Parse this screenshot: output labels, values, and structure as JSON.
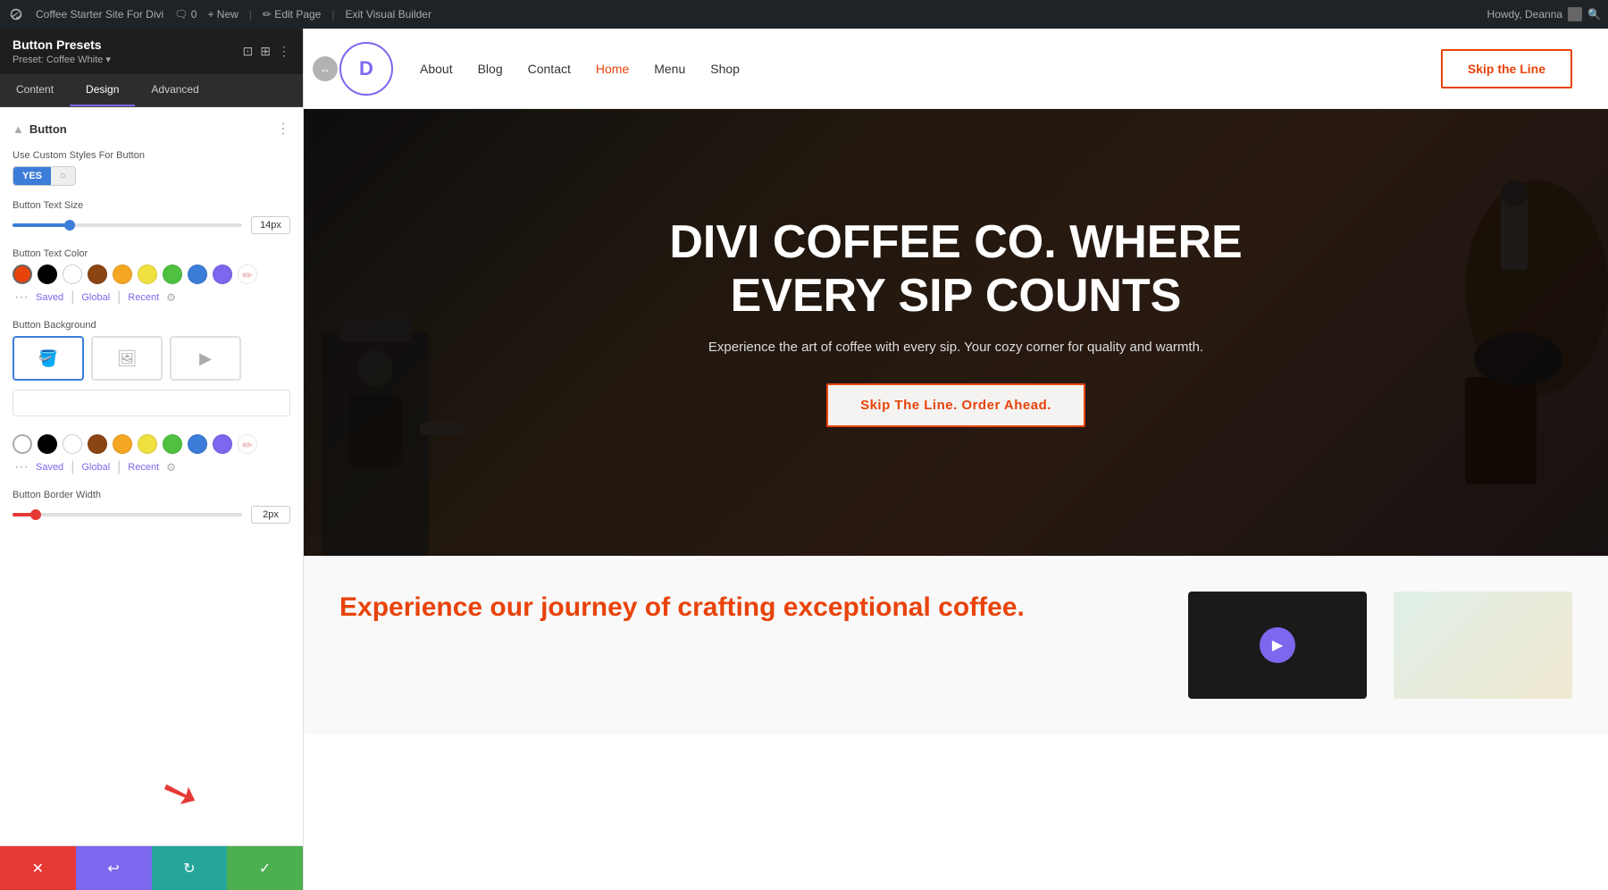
{
  "admin_bar": {
    "wp_label": "⊕",
    "site_name": "Coffee Starter Site For Divi",
    "comments_count": "0",
    "new_label": "+ New",
    "edit_page_label": "✏ Edit Page",
    "exit_vb_label": "Exit Visual Builder",
    "howdy_label": "Howdy, Deanna",
    "search_icon": "🔍"
  },
  "left_panel": {
    "title": "Button Presets",
    "subtitle": "Preset: Coffee White ▾",
    "tabs": [
      {
        "label": "Content",
        "active": false
      },
      {
        "label": "Design",
        "active": true
      },
      {
        "label": "Advanced",
        "active": false
      }
    ],
    "section_title": "Button",
    "toggle_label": "Use Custom Styles For Button",
    "toggle_yes": "YES",
    "toggle_no": "",
    "text_size_label": "Button Text Size",
    "text_size_value": "14px",
    "text_size_percent": 25,
    "text_color_label": "Button Text Color",
    "colors": [
      {
        "name": "orange-red",
        "hex": "#e8430a",
        "active": true
      },
      {
        "name": "black",
        "hex": "#000000"
      },
      {
        "name": "white",
        "hex": "#ffffff"
      },
      {
        "name": "brown",
        "hex": "#8b4513"
      },
      {
        "name": "orange",
        "hex": "#f5a623"
      },
      {
        "name": "yellow",
        "hex": "#f0e040"
      },
      {
        "name": "green",
        "hex": "#50c040"
      },
      {
        "name": "blue",
        "hex": "#3b7dd8"
      },
      {
        "name": "purple",
        "hex": "#7b68ee"
      }
    ],
    "color_meta_saved": "Saved",
    "color_meta_global": "Global",
    "color_meta_recent": "Recent",
    "bg_label": "Button Background",
    "bg_options": [
      {
        "type": "fill",
        "icon": "🪣"
      },
      {
        "type": "image",
        "icon": "🖼"
      },
      {
        "type": "video",
        "icon": "▶"
      }
    ],
    "colors_2": [
      {
        "name": "black2",
        "hex": "#000000"
      },
      {
        "name": "white2",
        "hex": "#ffffff"
      },
      {
        "name": "brown2",
        "hex": "#8b4513"
      },
      {
        "name": "orange2",
        "hex": "#f5a623"
      },
      {
        "name": "yellow2",
        "hex": "#f0e040"
      },
      {
        "name": "green2",
        "hex": "#50c040"
      },
      {
        "name": "blue2",
        "hex": "#3b7dd8"
      },
      {
        "name": "purple2",
        "hex": "#7b68ee"
      }
    ],
    "color2_meta_saved": "Saved",
    "color2_meta_global": "Global",
    "color2_meta_recent": "Recent",
    "border_width_label": "Button Border Width",
    "border_width_value": "2px",
    "border_width_percent": 10
  },
  "bottom_bar": {
    "cancel_icon": "✕",
    "undo_icon": "↩",
    "redo_icon": "↻",
    "save_icon": "✓"
  },
  "site_nav": {
    "logo_letter": "D",
    "menu_items": [
      {
        "label": "About",
        "active": false
      },
      {
        "label": "Blog",
        "active": false
      },
      {
        "label": "Contact",
        "active": false
      },
      {
        "label": "Home",
        "active": true
      },
      {
        "label": "Menu",
        "active": false
      },
      {
        "label": "Shop",
        "active": false
      }
    ],
    "cta_label": "Skip the Line"
  },
  "hero": {
    "title": "DIVI COFFEE CO. WHERE EVERY SIP COUNTS",
    "subtitle": "Experience the art of coffee with every sip. Your cozy corner for quality and warmth.",
    "cta_label": "Skip The Line. Order Ahead."
  },
  "below_hero": {
    "title": "Experience our journey of crafting exceptional coffee.",
    "play_icon": "▶"
  }
}
